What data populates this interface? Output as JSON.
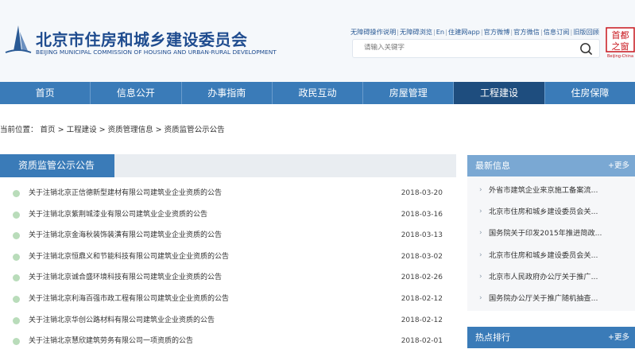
{
  "header": {
    "title_cn": "北京市住房和城乡建设委员会",
    "title_en": "BEIJING MUNICIPAL COMMISSION OF HOUSING AND URBAN-RURAL DEVELOPMENT",
    "top_links": [
      "无障碍操作说明",
      "无障碍浏览",
      "En",
      "住建网app",
      "官方微博",
      "官方微信",
      "信息订阅",
      "旧版回顾"
    ],
    "search_placeholder": "请输入关键字",
    "badge_cn_1": "首都",
    "badge_cn_2": "之窗",
    "badge_en": "Beijing-China"
  },
  "nav": {
    "items": [
      "首页",
      "信息公开",
      "办事指南",
      "政民互动",
      "房屋管理",
      "工程建设",
      "住房保障"
    ],
    "active_index": 5
  },
  "breadcrumb": {
    "prefix": "当前位置：",
    "items": [
      "首页",
      "工程建设",
      "资质管理信息",
      "资质监管公示公告"
    ],
    "separator": " > "
  },
  "main": {
    "tab_label": "资质监管公示公告",
    "items": [
      {
        "title": "关于注销北京正信德新型建材有限公司建筑业企业资质的公告",
        "date": "2018-03-20"
      },
      {
        "title": "关于注销北京紫荆城漆业有限公司建筑业企业资质的公告",
        "date": "2018-03-16"
      },
      {
        "title": "关于注销北京金海秋装饰装潢有限公司建筑业企业资质的公告",
        "date": "2018-03-13"
      },
      {
        "title": "关于注销北京恒鼎义和节能科技有限公司建筑业企业资质的公告",
        "date": "2018-03-02"
      },
      {
        "title": "关于注销北京诚合盛环境科技有限公司建筑业企业资质的公告",
        "date": "2018-02-26"
      },
      {
        "title": "关于注销北京利海百强市政工程有限公司建筑业企业资质的公告",
        "date": "2018-02-12"
      },
      {
        "title": "关于注销北京华创公路材料有限公司建筑业企业资质的公告",
        "date": "2018-02-12"
      },
      {
        "title": "关于注销北京慧欣建筑劳务有限公司一项资质的公告",
        "date": "2018-02-01"
      }
    ]
  },
  "sidebar": {
    "news": {
      "title": "最新信息",
      "more": "+更多",
      "items": [
        "外省市建筑企业来京施工备案流...",
        "北京市住房和城乡建设委员会关...",
        "国务院关于印发2015年推进简政...",
        "北京市住房和城乡建设委员会关...",
        "北京市人民政府办公厅关于推广...",
        "国务院办公厅关于推广随机抽查..."
      ]
    },
    "hot": {
      "title": "热点排行",
      "more": "+更多"
    }
  },
  "colors": {
    "nav_bg": "#3a7bb8",
    "nav_active": "#1e4d7e",
    "brand_blue": "#1f4c8f",
    "dot_green": "#b9dcba"
  }
}
